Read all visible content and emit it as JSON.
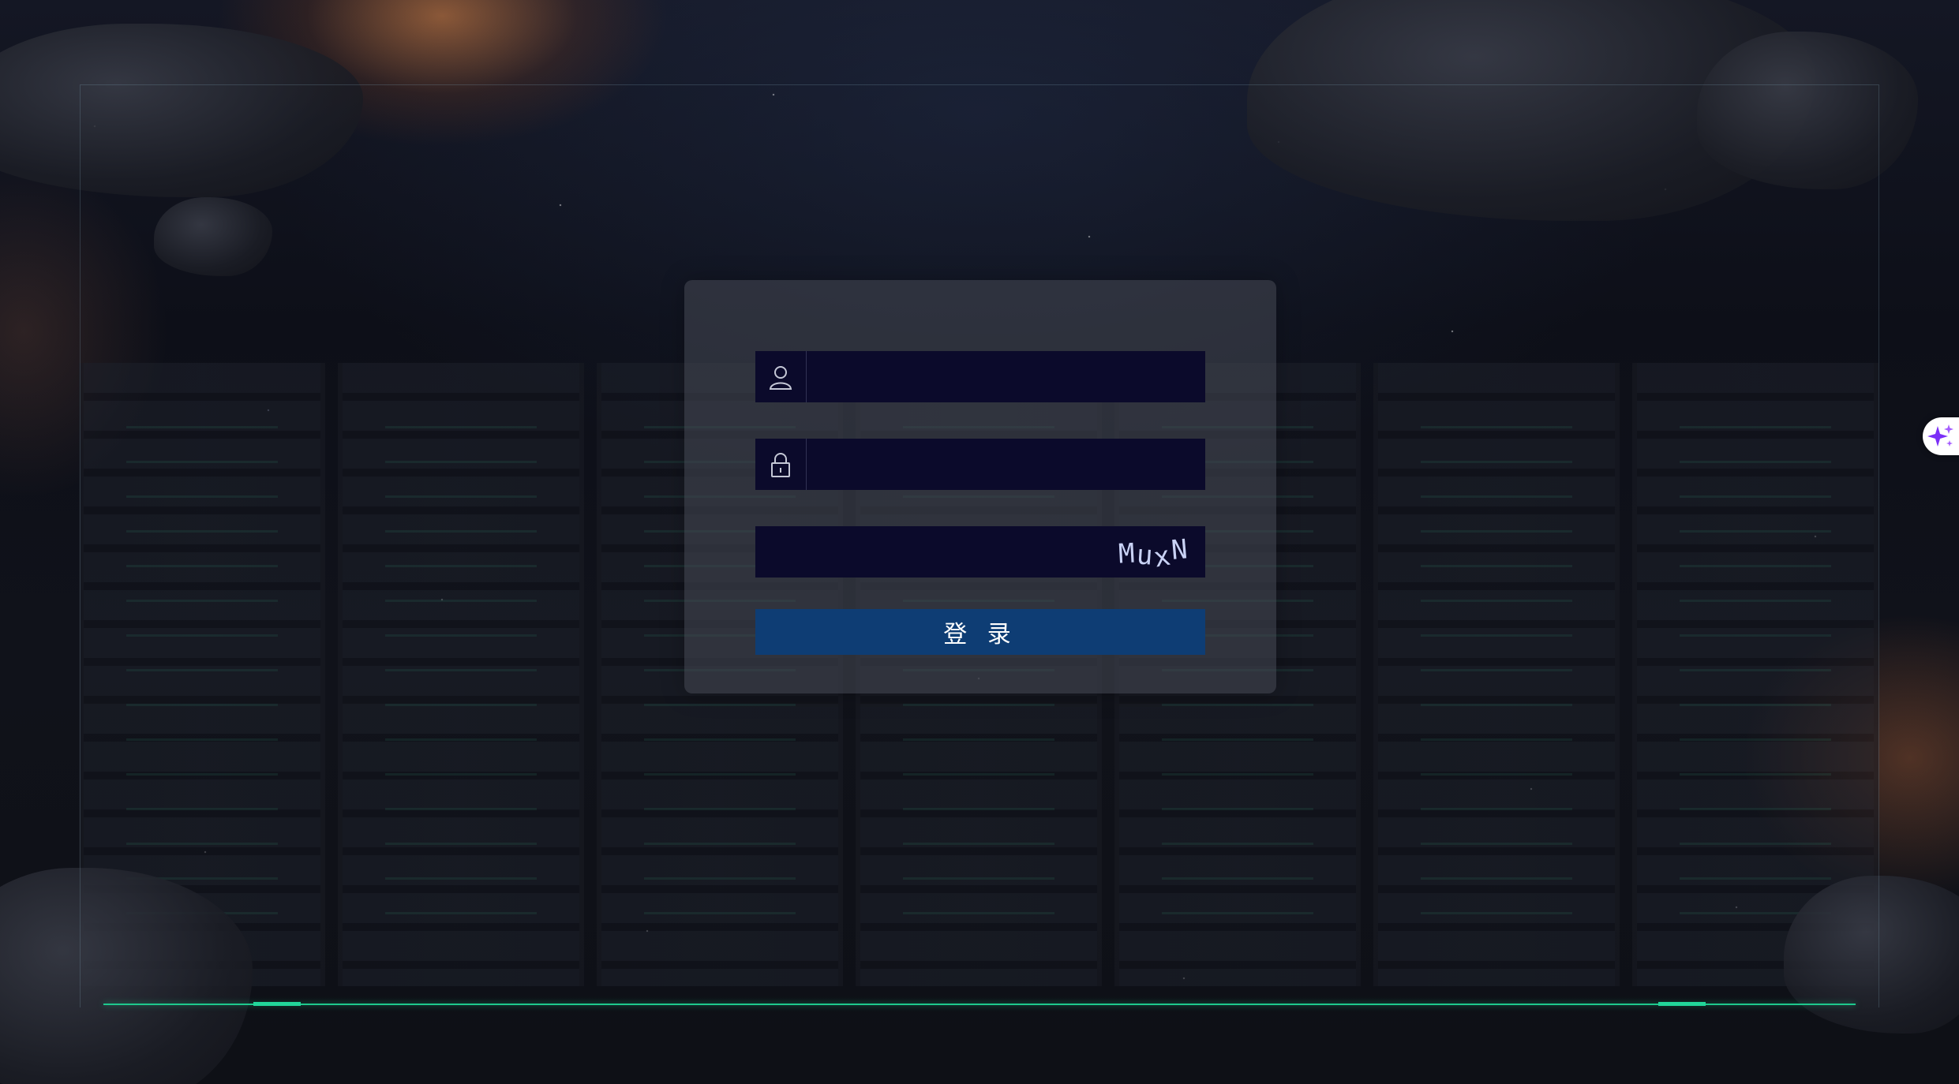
{
  "login": {
    "username": {
      "icon": "user-icon",
      "placeholder": "",
      "value": ""
    },
    "password": {
      "icon": "lock-icon",
      "placeholder": "",
      "value": ""
    },
    "captcha": {
      "placeholder": "",
      "value": "",
      "code": [
        "M",
        "u",
        "x",
        "N"
      ]
    },
    "submit_label": "登 录"
  },
  "side_widget": {
    "icon": "sparkle-icon"
  },
  "colors": {
    "panel": "#46485466",
    "field": "#0b0a2b",
    "button": "#0e3d74",
    "frame_accent": "#1ec98d",
    "sparkle": "#7b2ff7"
  }
}
